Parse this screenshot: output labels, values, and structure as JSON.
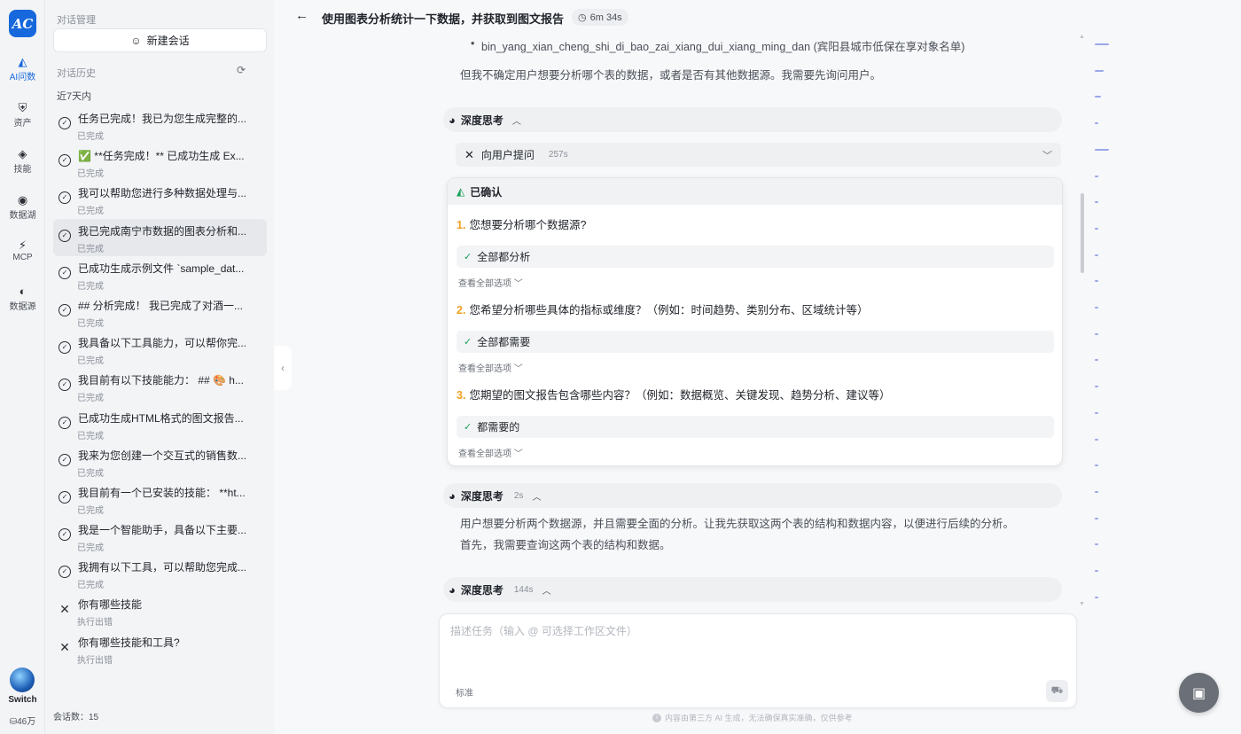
{
  "rail": {
    "items": [
      {
        "label": "AI问数",
        "icon": "ai-icon"
      },
      {
        "label": "资产",
        "icon": "assets-icon"
      },
      {
        "label": "技能",
        "icon": "skills-icon"
      },
      {
        "label": "数据湖",
        "icon": "datalake-icon"
      },
      {
        "label": "MCP",
        "icon": "mcp-icon"
      },
      {
        "label": "数据源",
        "icon": "datasource-icon"
      }
    ],
    "user_label": "Switch",
    "quota": "46万"
  },
  "sidebar": {
    "title": "对话管理",
    "new_chat": "新建会话",
    "history_title": "对话历史",
    "group": "近7天内",
    "conversations": [
      {
        "title": "任务已完成！我已为您生成完整的...",
        "status": "已完成",
        "state": "ok"
      },
      {
        "title": "✅ **任务完成！** 已成功生成 Ex...",
        "status": "已完成",
        "state": "ok"
      },
      {
        "title": "我可以帮助您进行多种数据处理与...",
        "status": "已完成",
        "state": "ok"
      },
      {
        "title": "我已完成南宁市数据的图表分析和...",
        "status": "已完成",
        "state": "ok",
        "active": true
      },
      {
        "title": "已成功生成示例文件 `sample_dat...",
        "status": "已完成",
        "state": "ok"
      },
      {
        "title": "## 分析完成！ 我已完成了对酒一...",
        "status": "已完成",
        "state": "ok"
      },
      {
        "title": "我具备以下工具能力，可以帮你完...",
        "status": "已完成",
        "state": "ok"
      },
      {
        "title": "我目前有以下技能能力： ## 🎨 h...",
        "status": "已完成",
        "state": "ok"
      },
      {
        "title": "已成功生成HTML格式的图文报告...",
        "status": "已完成",
        "state": "ok"
      },
      {
        "title": "我来为您创建一个交互式的销售数...",
        "status": "已完成",
        "state": "ok"
      },
      {
        "title": "我目前有一个已安装的技能： **ht...",
        "status": "已完成",
        "state": "ok"
      },
      {
        "title": "我是一个智能助手，具备以下主要...",
        "status": "已完成",
        "state": "ok"
      },
      {
        "title": "我拥有以下工具，可以帮助您完成...",
        "status": "已完成",
        "state": "ok"
      },
      {
        "title": "你有哪些技能",
        "status": "执行出错",
        "state": "err"
      },
      {
        "title": "你有哪些技能和工具?",
        "status": "执行出错",
        "state": "err"
      }
    ],
    "count_label": "会话数：15"
  },
  "main": {
    "title": "使用图表分析统计一下数据，并获取到图文报告",
    "timer": "6m 34s",
    "bullet": "bin_yang_xian_cheng_shi_di_bao_zai_xiang_dui_xiang_ming_dan (宾阳县城市低保在享对象名单)",
    "para1": "但我不确定用户想要分析哪个表的数据，或者是否有其他数据源。我需要先询问用户。",
    "think1": {
      "label": "深度思考",
      "time": ""
    },
    "tool": {
      "label": "向用户提问",
      "time": "257s"
    },
    "confirm": {
      "header": "已确认",
      "questions": [
        {
          "num": "1.",
          "text": "您想要分析哪个数据源?",
          "answer": "全部都分析",
          "view_all": "查看全部选项"
        },
        {
          "num": "2.",
          "text": "您希望分析哪些具体的指标或维度？（例如：时间趋势、类别分布、区域统计等）",
          "answer": "全部都需要",
          "view_all": "查看全部选项"
        },
        {
          "num": "3.",
          "text": "您期望的图文报告包含哪些内容？（例如：数据概览、关键发现、趋势分析、建议等）",
          "answer": "都需要的",
          "view_all": "查看全部选项"
        }
      ]
    },
    "think2": {
      "label": "深度思考",
      "time": "2s"
    },
    "para2": "用户想要分析两个数据源，并且需要全面的分析。让我先获取这两个表的结构和数据内容，以便进行后续的分析。",
    "para3": "首先，我需要查询这两个表的结构和数据。",
    "think3": {
      "label": "深度思考",
      "time": "144s"
    },
    "input_placeholder": "描述任务（输入 @ 可选择工作区文件）",
    "mode_label": "标准",
    "disclaimer": "内容由第三方 AI 生成，无法确保真实准确，仅供参考"
  },
  "colors": {
    "accent": "#1668dc",
    "success": "#18a058",
    "number": "#f0a020"
  }
}
